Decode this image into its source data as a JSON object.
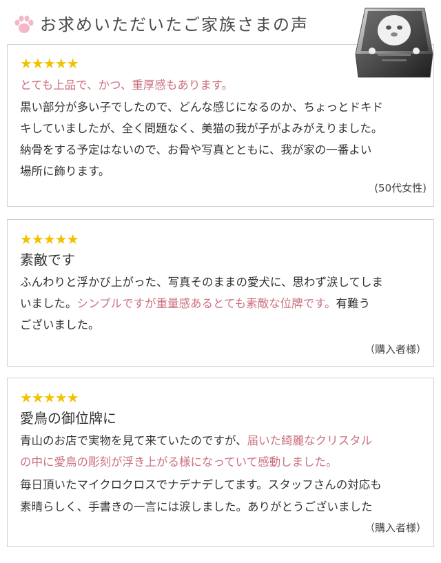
{
  "header": {
    "title": "お求めいただいたご家族さまの声"
  },
  "reviews": [
    {
      "stars": "★★★★★",
      "highlight": "とても上品で、かつ、重厚感もあります。",
      "lines": [
        "黒い部分が多い子でしたので、どんな感じになるのか、ちょっとドキド",
        "キしていましたが、全く問題なく、美猫の我が子がよみがえりました。",
        "納骨をする予定はないので、お骨や写真とともに、我が家の一番よい",
        "場所に飾ります。"
      ],
      "signature": "(50代女性)"
    },
    {
      "stars": "★★★★★",
      "title": "素敵です",
      "line1": "ふんわりと浮かび上がった、写真そのままの愛犬に、思わず涙してしま",
      "line2_plain": "いました。",
      "line2_pink": "シンプルですが重量感あるとても素敵な位牌です。",
      "line2_tail": "有難う",
      "line3": "ございました。",
      "signature": "（購入者様）"
    },
    {
      "stars": "★★★★★",
      "title": "愛鳥の御位牌に",
      "line1_plain": "青山のお店で実物を見て来ていたのですが、",
      "line1_pink": "届いた綺麗なクリスタル",
      "line2_pink": "の中に愛鳥の彫刻が浮き上がる様になっていて感動しました。",
      "line3": "毎日頂いたマイクロクロスでナデナデしてます。スタッフさんの対応も",
      "line4": "素晴らしく、手書きの一言には涙しました。ありがとうございました",
      "signature": "（購入者様）"
    }
  ],
  "colors": {
    "accent_pink": "#cc7080",
    "star": "#f2c200",
    "paw": "#f2b8c6"
  }
}
